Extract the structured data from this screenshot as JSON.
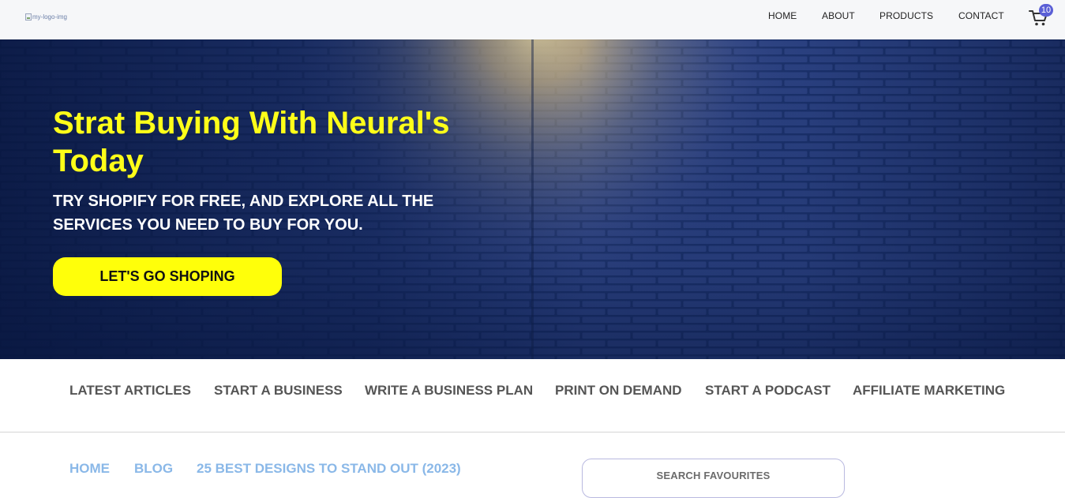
{
  "header": {
    "logo_alt": "my-logo-img",
    "nav": [
      "HOME",
      "ABOUT",
      "PRODUCTS",
      "CONTACT"
    ],
    "cart_icon": "cart-icon",
    "cart_count": "10"
  },
  "hero": {
    "title": "Strat Buying With Neural's Today",
    "subtitle": "TRY SHOPIFY FOR FREE, AND EXPLORE ALL THE SERVICES YOU NEED TO BUY FOR YOU.",
    "cta_label": "LET'S GO SHOPING",
    "title_color": "#ffff19",
    "cta_color": "#ffff0a",
    "background_color": "#0f2150"
  },
  "categories": [
    "LATEST ARTICLES",
    "START A BUSINESS",
    "WRITE A BUSINESS PLAN",
    "PRINT ON DEMAND",
    "START A PODCAST",
    "AFFILIATE MARKETING"
  ],
  "breadcrumb": [
    "HOME",
    "BLOG",
    "25 BEST DESIGNS TO STAND OUT (2023)"
  ],
  "search": {
    "placeholder": "SEARCH FAVOURITES"
  }
}
